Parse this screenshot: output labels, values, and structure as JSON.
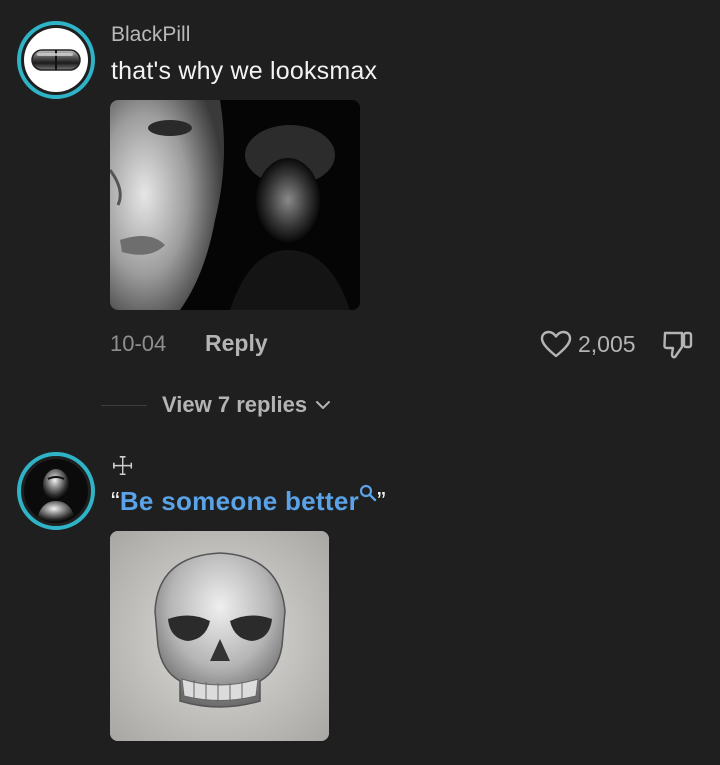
{
  "comments": [
    {
      "username": "BlackPill",
      "text": "that's why we looksmax",
      "date": "10-04",
      "reply_label": "Reply",
      "likes": "2,005",
      "view_replies": "View 7 replies"
    },
    {
      "username": "☩",
      "text_open_quote": "“",
      "text_link": "Be someone better",
      "text_close_quote": "”"
    }
  ],
  "colors": {
    "background": "#1f1f1f",
    "avatar_ring": "#2fb3c6",
    "link": "#5aa3e8"
  },
  "icons": [
    "pill-icon",
    "heart-icon",
    "thumbs-down-icon",
    "chevron-down-icon",
    "search-icon"
  ]
}
